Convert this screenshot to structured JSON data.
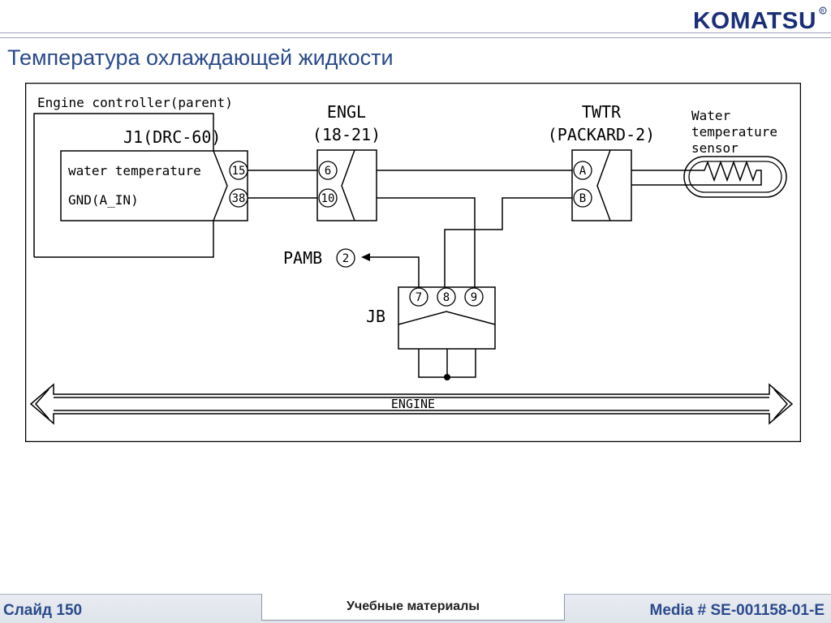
{
  "header": {
    "logo_text": "KOMATSU",
    "title": "Температура охлаждающей жидкости"
  },
  "diagram": {
    "controller": {
      "caption": "Engine controller(parent)",
      "connector_label": "J1(DRC-60)",
      "signals": [
        {
          "name": "water temperature",
          "pin": "15"
        },
        {
          "name": "GND(A_IN)",
          "pin": "38"
        }
      ]
    },
    "engl": {
      "name": "ENGL",
      "pins_range": "(18-21)",
      "pins": [
        "6",
        "10"
      ]
    },
    "twtr": {
      "name": "TWTR",
      "type": "(PACKARD-2)",
      "pins": [
        "A",
        "B"
      ]
    },
    "sensor": {
      "label_lines": [
        "Water",
        "temperature",
        "sensor"
      ]
    },
    "pamb": {
      "label": "PAMB",
      "pin": "2"
    },
    "jb": {
      "label": "JB",
      "pins": [
        "7",
        "8",
        "9"
      ]
    },
    "engine_label": "ENGINE"
  },
  "footer": {
    "slide": "Слайд 150",
    "center": "Учебные материалы",
    "media": "Media # SE-001158-01-E"
  }
}
